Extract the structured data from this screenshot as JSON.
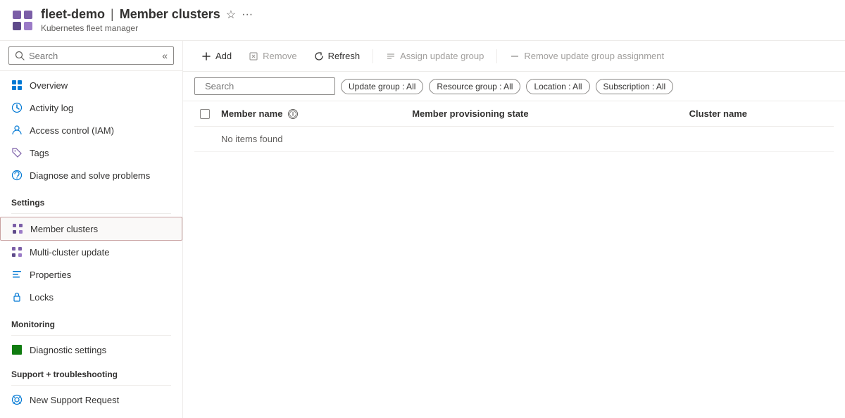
{
  "header": {
    "resource_name": "fleet-demo",
    "separator": "|",
    "page_name": "Member clusters",
    "subtitle": "Kubernetes fleet manager",
    "favorite_icon": "★",
    "more_icon": "···"
  },
  "sidebar": {
    "search_placeholder": "Search",
    "collapse_title": "Collapse",
    "nav_items": [
      {
        "id": "overview",
        "label": "Overview",
        "icon": "overview"
      },
      {
        "id": "activity-log",
        "label": "Activity log",
        "icon": "activity"
      },
      {
        "id": "access-control",
        "label": "Access control (IAM)",
        "icon": "access"
      },
      {
        "id": "tags",
        "label": "Tags",
        "icon": "tags"
      },
      {
        "id": "diagnose",
        "label": "Diagnose and solve problems",
        "icon": "diagnose"
      }
    ],
    "settings_label": "Settings",
    "settings_items": [
      {
        "id": "member-clusters",
        "label": "Member clusters",
        "icon": "clusters",
        "active": true
      },
      {
        "id": "multi-cluster",
        "label": "Multi-cluster update",
        "icon": "update"
      },
      {
        "id": "properties",
        "label": "Properties",
        "icon": "properties"
      },
      {
        "id": "locks",
        "label": "Locks",
        "icon": "locks"
      }
    ],
    "monitoring_label": "Monitoring",
    "monitoring_items": [
      {
        "id": "diagnostic-settings",
        "label": "Diagnostic settings",
        "icon": "diagnostic"
      }
    ],
    "support_label": "Support + troubleshooting",
    "support_items": [
      {
        "id": "new-support",
        "label": "New Support Request",
        "icon": "support"
      }
    ]
  },
  "toolbar": {
    "add_label": "Add",
    "remove_label": "Remove",
    "refresh_label": "Refresh",
    "assign_label": "Assign update group",
    "remove_assignment_label": "Remove update group assignment"
  },
  "filters": {
    "search_placeholder": "Search",
    "pills": [
      {
        "id": "update-group",
        "label": "Update group : All"
      },
      {
        "id": "resource-group",
        "label": "Resource group : All"
      },
      {
        "id": "location",
        "label": "Location : All"
      },
      {
        "id": "subscription",
        "label": "Subscription : All"
      }
    ]
  },
  "table": {
    "columns": [
      {
        "id": "member-name",
        "label": "Member name",
        "has_info": true
      },
      {
        "id": "provisioning-state",
        "label": "Member provisioning state"
      },
      {
        "id": "cluster-name",
        "label": "Cluster name"
      }
    ],
    "no_items_text": "No items found"
  }
}
